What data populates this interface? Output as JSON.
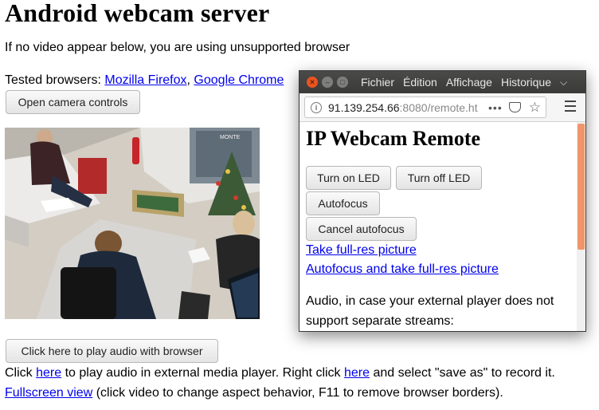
{
  "page": {
    "title": "Android webcam server",
    "unsupported_notice": "If no video appear below, you are using unsupported browser",
    "tested_prefix": "Tested browsers: ",
    "browsers": [
      "Mozilla Firefox",
      "Google Chrome"
    ],
    "browser_separator": ", ",
    "camera_controls_button": "Open camera controls",
    "play_audio_button": "Click here to play audio with browser",
    "audio_line": {
      "part1": "Click ",
      "link1": "here",
      "part2": " to play audio in external media player. Right click ",
      "link2": "here",
      "part3": " and select \"save as\" to record it."
    },
    "fullscreen_line": {
      "link": "Fullscreen view",
      "text": " (click video to change aspect behavior, F11 to remove browser borders)."
    }
  },
  "camera": {
    "overlay_text": "MONTE"
  },
  "remote_window": {
    "menu": [
      "Fichier",
      "Édition",
      "Affichage",
      "Historique"
    ],
    "url_host": "91.139.254.66",
    "url_path": ":8080/remote.ht",
    "heading": "IP Webcam Remote",
    "buttons": {
      "led_on": "Turn on LED",
      "led_off": "Turn off LED",
      "autofocus": "Autofocus",
      "cancel_autofocus": "Cancel autofocus"
    },
    "links": {
      "take_picture": "Take full-res picture",
      "autofocus_picture": "Autofocus and take full-res picture"
    },
    "audio_text_1": "Audio, in case your external player does not",
    "audio_text_2": "support separate streams:"
  },
  "colors": {
    "link": "#0000ee",
    "titlebar": "#3c3b37",
    "close_button": "#e95420",
    "scroll_thumb": "#f0956a"
  }
}
